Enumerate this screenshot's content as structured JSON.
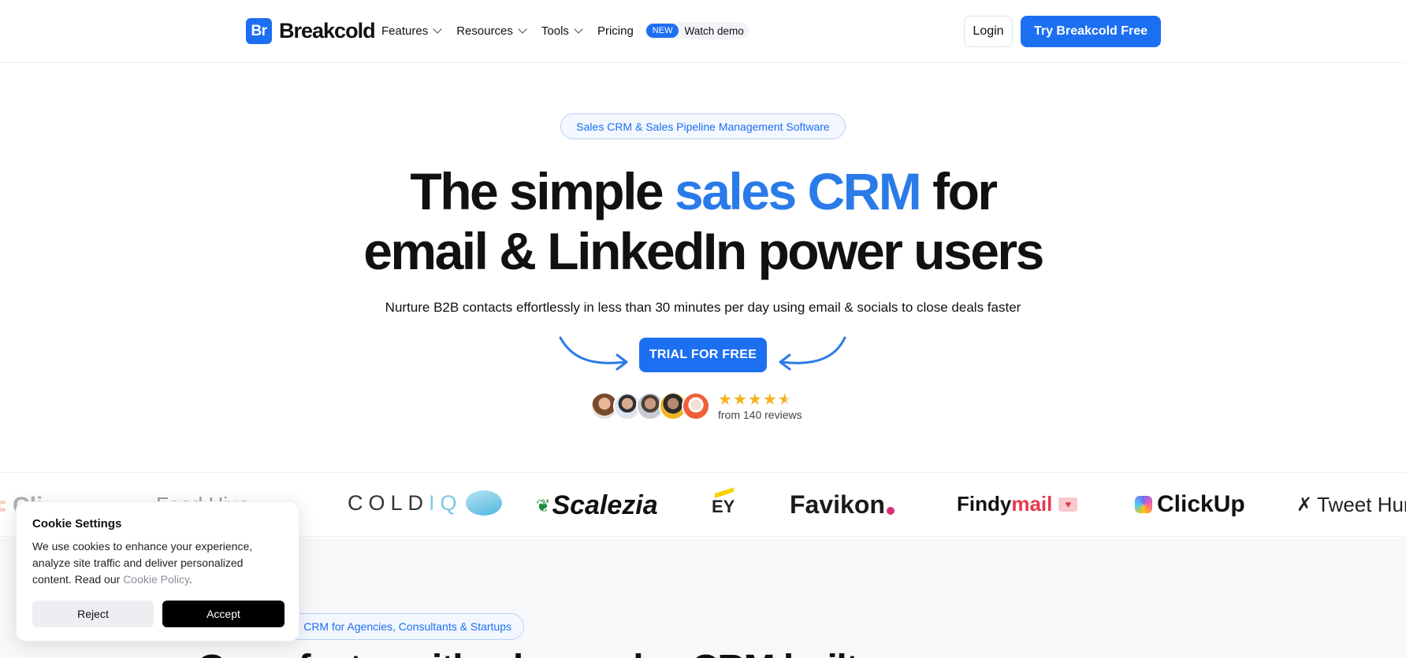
{
  "header": {
    "logo_mark": "Br",
    "logo_text": "Breakcold",
    "nav": [
      {
        "label": "Features"
      },
      {
        "label": "Resources"
      },
      {
        "label": "Tools"
      },
      {
        "label": "Pricing"
      }
    ],
    "new_badge": "NEW",
    "watch_demo": "Watch demo",
    "login": "Login",
    "try_free": "Try Breakcold Free"
  },
  "hero": {
    "badge": "Sales CRM & Sales Pipeline Management Software",
    "headline_part1": "The simple ",
    "headline_accent": "sales CRM",
    "headline_part2": " for",
    "headline_line2": "email & LinkedIn power users",
    "subtext": "Nurture B2B contacts effortlessly in less than 30 minutes per day using email & socials to close deals faster",
    "cta": "TRIAL FOR FREE",
    "rating": 4.5,
    "stars": "★★★★★",
    "reviews": "from 140 reviews"
  },
  "client_logos": [
    {
      "name": "ClickUp (partial)",
      "text": "ClickUp"
    },
    {
      "name": "Feed Hive (partial)",
      "text": "Feed Hive"
    },
    {
      "name": "ColdIQ",
      "text": "COLD",
      "text2": "IQ"
    },
    {
      "name": "Scalezia",
      "text": "Scalezia"
    },
    {
      "name": "EY",
      "text": "EY"
    },
    {
      "name": "Favikon",
      "text": "Favikon"
    },
    {
      "name": "Findymail",
      "text": "Findy",
      "text2": "mail"
    },
    {
      "name": "ClickUp",
      "text": "ClickUp"
    },
    {
      "name": "Tweet Hunter",
      "text": "Tweet Hun"
    }
  ],
  "lower": {
    "badge": "CRM for Agencies, Consultants & Startups",
    "heading_peek": "Grow faster with a lean sales CRM built"
  },
  "cookie": {
    "title": "Cookie Settings",
    "body": "We use cookies to enhance your experience, analyze site traffic and deliver personalized content. Read our ",
    "link": "Cookie Policy",
    "period": ".",
    "reject": "Reject",
    "accept": "Accept"
  },
  "colors": {
    "brand": "#1d6ff2",
    "accent_text": "#2a7be9",
    "star": "#f5b21b"
  }
}
